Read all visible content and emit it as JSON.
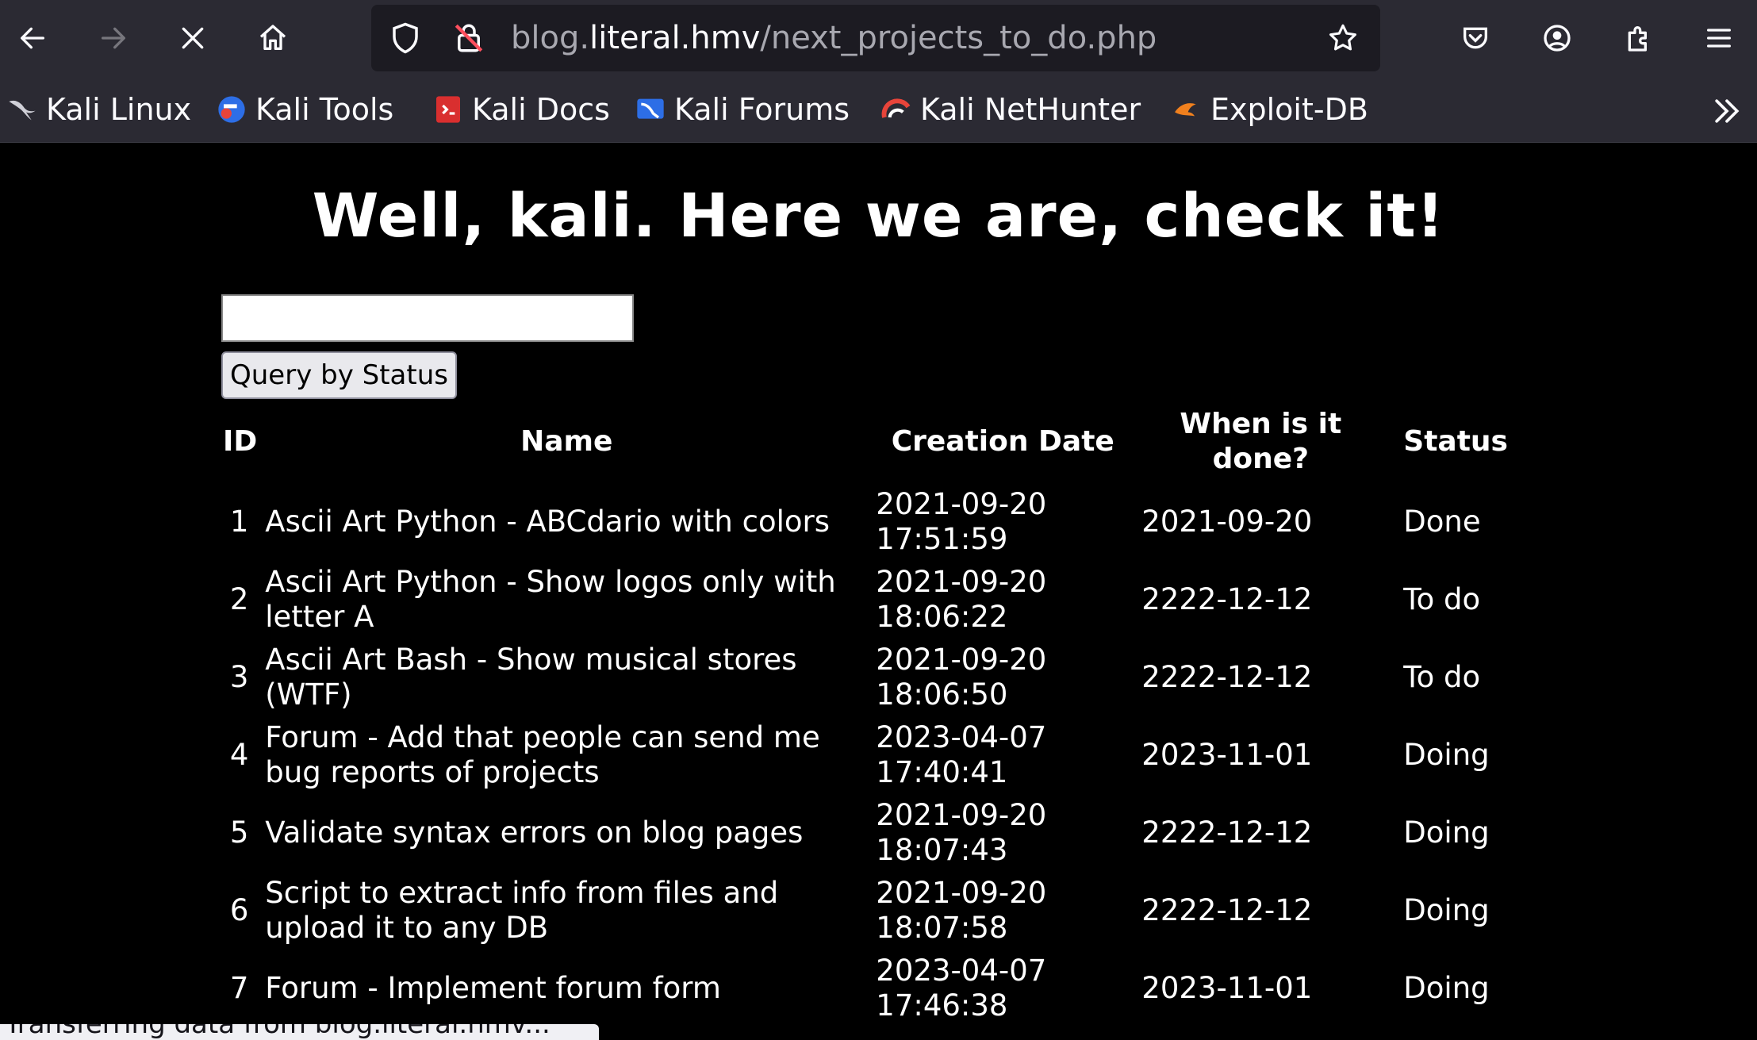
{
  "browser": {
    "url_prefix": "blog.",
    "url_domain": "literal.hmv",
    "url_path": "/next_projects_to_do.php",
    "bookmarks": [
      {
        "label": "Kali Linux",
        "icon": "kali-dragon-icon"
      },
      {
        "label": "Kali Tools",
        "icon": "kali-tools-icon"
      },
      {
        "label": "Kali Docs",
        "icon": "kali-docs-icon"
      },
      {
        "label": "Kali Forums",
        "icon": "kali-forums-icon"
      },
      {
        "label": "Kali NetHunter",
        "icon": "kali-nethunter-icon"
      },
      {
        "label": "Exploit-DB",
        "icon": "exploit-db-icon"
      }
    ]
  },
  "page": {
    "heading": "Well, kali. Here we are, check it!",
    "input_value": "",
    "query_button": "Query by Status",
    "status_text": "Transferring data from blog.literal.hmv..."
  },
  "table": {
    "headers": {
      "id": "ID",
      "name": "Name",
      "creation_date": "Creation Date",
      "when_done": "When is it done?",
      "status": "Status"
    },
    "rows": [
      {
        "id": "1",
        "name": "Ascii Art Python - ABCdario with colors",
        "created": "2021-09-20 17:51:59",
        "done": "2021-09-20",
        "status": "Done"
      },
      {
        "id": "2",
        "name": "Ascii Art Python - Show logos only with letter A",
        "created": "2021-09-20 18:06:22",
        "done": "2222-12-12",
        "status": "To do"
      },
      {
        "id": "3",
        "name": "Ascii Art Bash - Show musical stores (WTF)",
        "created": "2021-09-20 18:06:50",
        "done": "2222-12-12",
        "status": "To do"
      },
      {
        "id": "4",
        "name": "Forum - Add that people can send me bug reports of projects",
        "created": "2023-04-07 17:40:41",
        "done": "2023-11-01",
        "status": "Doing"
      },
      {
        "id": "5",
        "name": "Validate syntax errors on blog pages",
        "created": "2021-09-20 18:07:43",
        "done": "2222-12-12",
        "status": "Doing"
      },
      {
        "id": "6",
        "name": "Script to extract info from files and upload it to any DB",
        "created": "2021-09-20 18:07:58",
        "done": "2222-12-12",
        "status": "Doing"
      },
      {
        "id": "7",
        "name": "Forum - Implement forum form",
        "created": "2023-04-07 17:46:38",
        "done": "2023-11-01",
        "status": "Doing"
      }
    ]
  }
}
